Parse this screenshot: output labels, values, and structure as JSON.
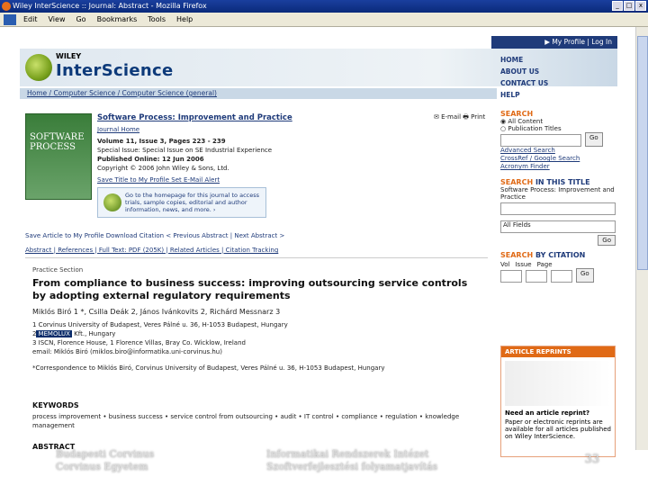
{
  "window": {
    "title": "Wiley InterScience :: Journal: Abstract - Mozilla Firefox"
  },
  "menu": [
    "Edit",
    "View",
    "Go",
    "Bookmarks",
    "Tools",
    "Help"
  ],
  "topnav": {
    "label": "▶ My Profile  |  Log In"
  },
  "logo": {
    "brand": "WILEY",
    "name": "InterScience"
  },
  "rightnav": [
    "HOME",
    "ABOUT US",
    "CONTACT US",
    "HELP"
  ],
  "breadcrumb": "Home / Computer Science / Computer Science (general)",
  "journal": {
    "title": "Software Process: Improvement and Practice",
    "links": "Journal Home",
    "volume": "Volume 11, Issue 3, Pages 223 - 239",
    "special": "Special Issue: Special Issue on SE Industrial Experience",
    "published": "Published Online: 12 Jun 2006",
    "copyright": "Copyright © 2006 John Wiley & Sons, Ltd.",
    "cover_text": "SOFTWARE PROCESS"
  },
  "emailprint": "✉ E-mail   🖶 Print",
  "save": "Save Title to My Profile    Set E-Mail Alert",
  "infobox": "Go to the homepage for this journal to access trials, sample copies, editorial and author information, news, and more. ›",
  "actions": "Save Article to My Profile    Download Citation          < Previous Abstract  |  Next Abstract >",
  "tabs": "Abstract  |  References  |  Full Text: PDF (205K)  |  Related Articles  |  Citation Tracking",
  "article": {
    "section": "Practice Section",
    "title": "From compliance to business success: improving outsourcing service controls by adopting external regulatory requirements",
    "authors": "Miklós Biró 1 *, Csilla Deák 2, János Ivánkovits 2, Richárd Messnarz 3",
    "affil1": "1 Corvinus University of Budapest, Veres Pálné u. 36, H-1053 Budapest, Hungary",
    "affil2_hl": "MEMOLUX",
    "affil2": " Kft., Hungary",
    "affil3": "3 ISCN, Florence House, 1 Florence Villas, Bray Co. Wicklow, Ireland",
    "email": "email: Miklós Biró (miklos.biro@informatika.uni-corvinus.hu)",
    "corr": "*Correspondence to Miklós Biró, Corvinus University of Budapest, Veres Pálné u. 36, H-1053 Budapest, Hungary",
    "kw_head": "KEYWORDS",
    "keywords": "process improvement • business success • service control from outsourcing • audit • IT control • compliance • regulation • knowledge management",
    "abs_head": "ABSTRACT"
  },
  "search": {
    "head1": "SEARCH",
    "opt1": "All Content",
    "opt2": "Publication Titles",
    "go": "Go",
    "links": [
      "Advanced Search",
      "CrossRef / Google Search",
      "Acronym Finder"
    ],
    "head2a": "SEARCH",
    "head2b": "IN THIS TITLE",
    "title_in": "Software Process: Improvement and Practice",
    "select": "All Fields",
    "head3a": "SEARCH",
    "head3b": "BY CITATION",
    "cite_labels": [
      "Vol",
      "Issue",
      "Page"
    ]
  },
  "reprints": {
    "head": "ARTICLE REPRINTS",
    "q": "Need an article reprint?",
    "text": "Paper or electronic reprints are available for all articles published on Wiley InterScience."
  },
  "footer": {
    "left1": "Budapesti Corvinus",
    "left2": "Corvinus Egyetem",
    "mid1": "Informatikai Rendszerek Intézet",
    "mid2": "Szoftverfejlesztési folyamatjavítás",
    "page": "33"
  }
}
